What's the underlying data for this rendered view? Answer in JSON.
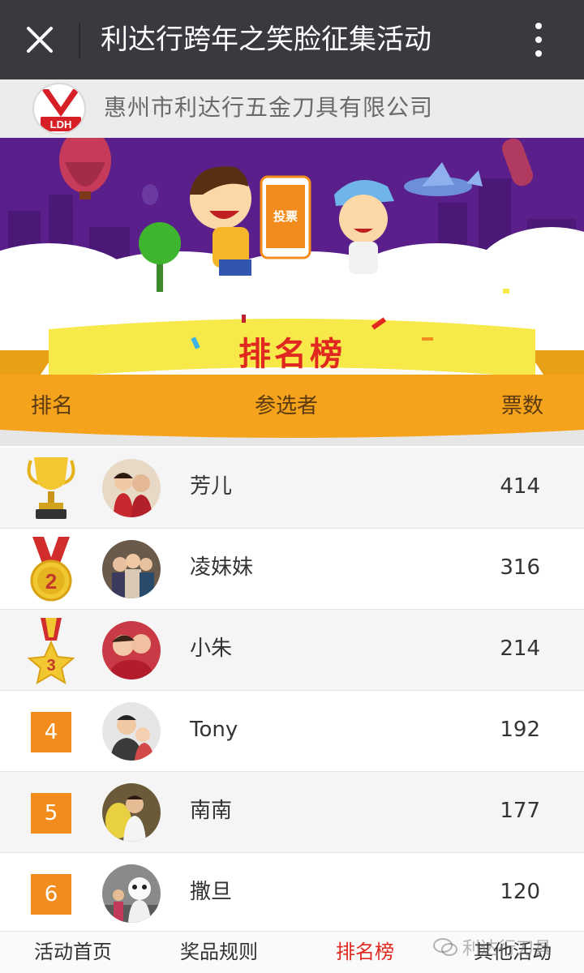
{
  "topbar": {
    "title": "利达行跨年之笑脸征集活动",
    "close_icon": "close-icon",
    "more_icon": "more-vertical-icon"
  },
  "company": {
    "logo_text": "LDH",
    "name": "惠州市利达行五金刀具有限公司"
  },
  "banner": {
    "vote_label": "投票",
    "board_title": "排名榜",
    "headers": {
      "rank": "排名",
      "contestant": "参选者",
      "votes": "票数"
    }
  },
  "ranking": [
    {
      "rank": "1",
      "name": "芳儿",
      "votes": "414",
      "badge": "trophy-icon"
    },
    {
      "rank": "2",
      "name": "凌妹妹",
      "votes": "316",
      "badge": "medal-icon"
    },
    {
      "rank": "3",
      "name": "小朱",
      "votes": "214",
      "badge": "star-medal-icon"
    },
    {
      "rank": "4",
      "name": "Tony",
      "votes": "192",
      "badge": ""
    },
    {
      "rank": "5",
      "name": "南南",
      "votes": "177",
      "badge": ""
    },
    {
      "rank": "6",
      "name": "撒旦",
      "votes": "120",
      "badge": ""
    }
  ],
  "nav": {
    "items": [
      {
        "label": "活动首页",
        "active": false
      },
      {
        "label": "奖品规则",
        "active": false
      },
      {
        "label": "排名榜",
        "active": true
      },
      {
        "label": "其他活动",
        "active": false
      }
    ]
  },
  "watermark": "利达行刀具",
  "colors": {
    "topbar": "#393a3f",
    "banner_purple": "#5a1f8a",
    "ribbon_yellow": "#f7e94a",
    "header_orange": "#f5a21c",
    "rank_box": "#f28c1c",
    "active_nav": "#e02820"
  }
}
